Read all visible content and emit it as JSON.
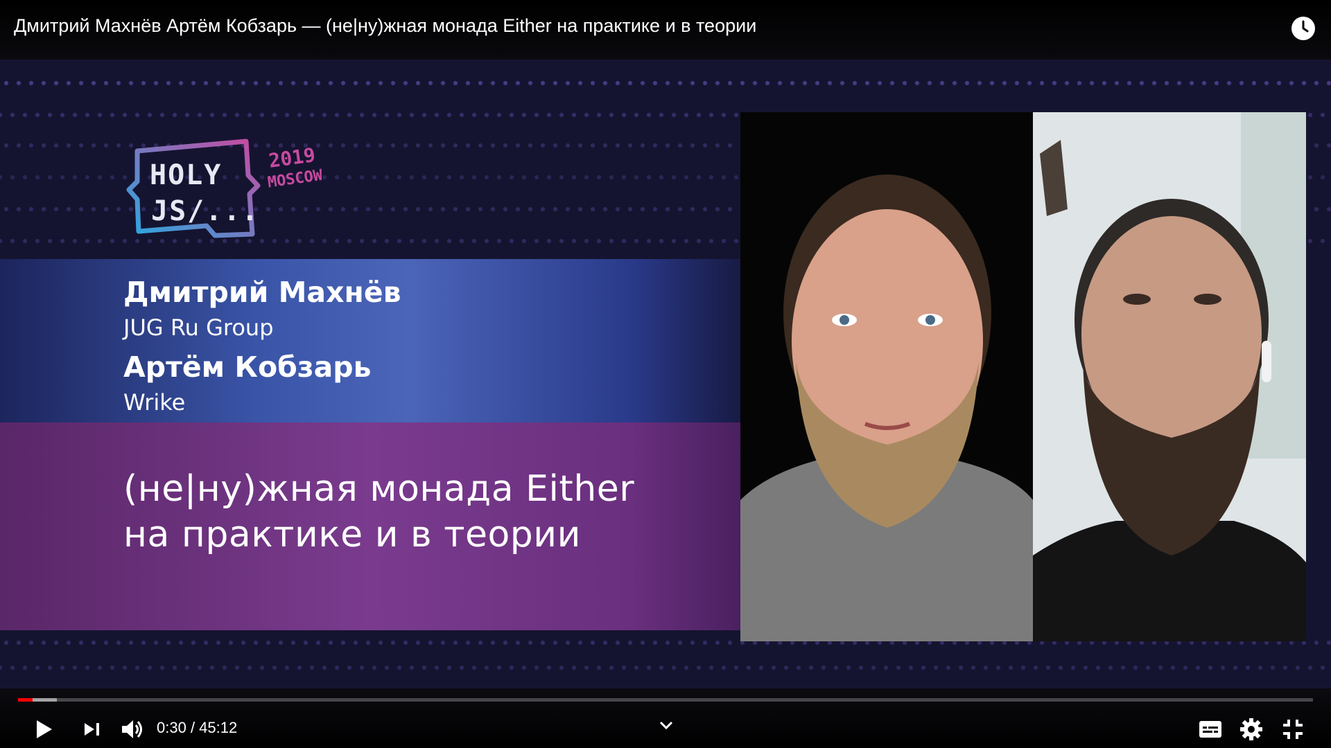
{
  "window": {
    "title": "Дмитрий Махнёв Артём Кобзарь — (не|ну)жная монада Either на практике и в теории"
  },
  "slide": {
    "logo": {
      "line1": "HOLY",
      "line2": "JS/...",
      "year": "2019",
      "city": "MOSCOW"
    },
    "speakers": [
      {
        "name": "Дмитрий Махнёв",
        "company": "JUG Ru Group"
      },
      {
        "name": "Артём Кобзарь",
        "company": "Wrike"
      }
    ],
    "talk_title_line1": "(не|ну)жная монада Either",
    "talk_title_line2": "на практике и в теории"
  },
  "player": {
    "current_time": "0:30",
    "separator": " / ",
    "duration": "45:12",
    "progress_played": 0.011,
    "progress_buffered": 0.03,
    "icons": [
      "watch-later-icon",
      "play-icon",
      "next-icon",
      "volume-icon",
      "chevron-down-icon",
      "subtitles-icon",
      "settings-icon",
      "exit-fullscreen-icon"
    ]
  },
  "colors": {
    "accent": "#ff0000",
    "logo_blue": "#2aa8e0",
    "logo_pink": "#c84aa0",
    "band_purple": "#7a3b8e"
  }
}
